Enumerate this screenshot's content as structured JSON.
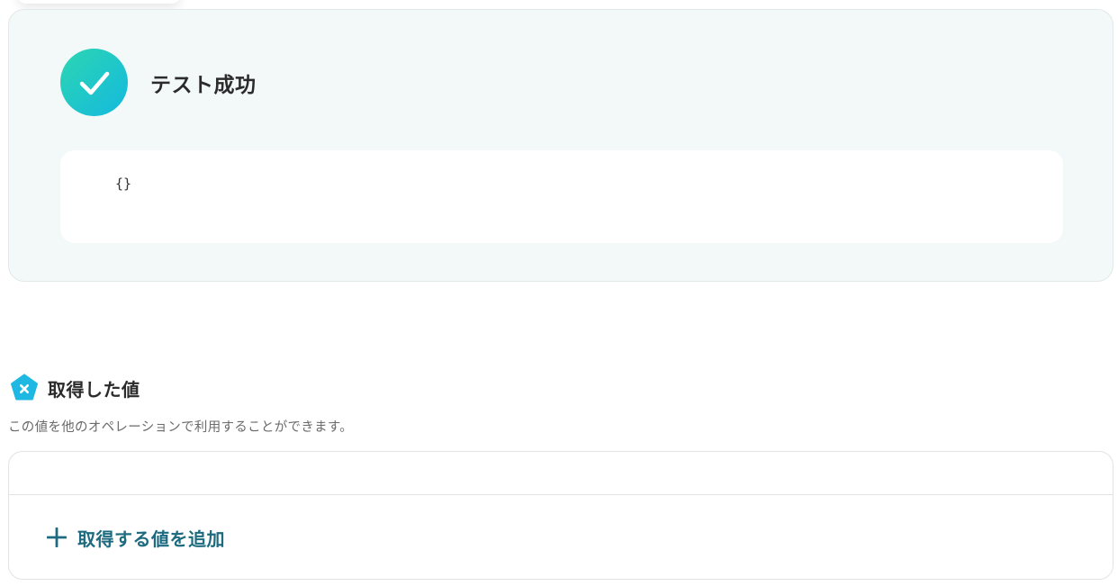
{
  "test_result": {
    "status_icon": "check-circle-icon",
    "title": "テスト成功",
    "output": "{}"
  },
  "acquired_values": {
    "icon": "x-badge-icon",
    "title": "取得した値",
    "description": "この値を他のオペレーションで利用することができます。",
    "add_button": {
      "icon": "plus-icon",
      "label": "取得する値を追加"
    }
  },
  "colors": {
    "success_gradient_start": "#2cd6b2",
    "success_gradient_end": "#14b9de",
    "panel_background": "#f2f9f8",
    "section_icon": "#1fb8e3",
    "accent_text": "#1e6b80"
  }
}
